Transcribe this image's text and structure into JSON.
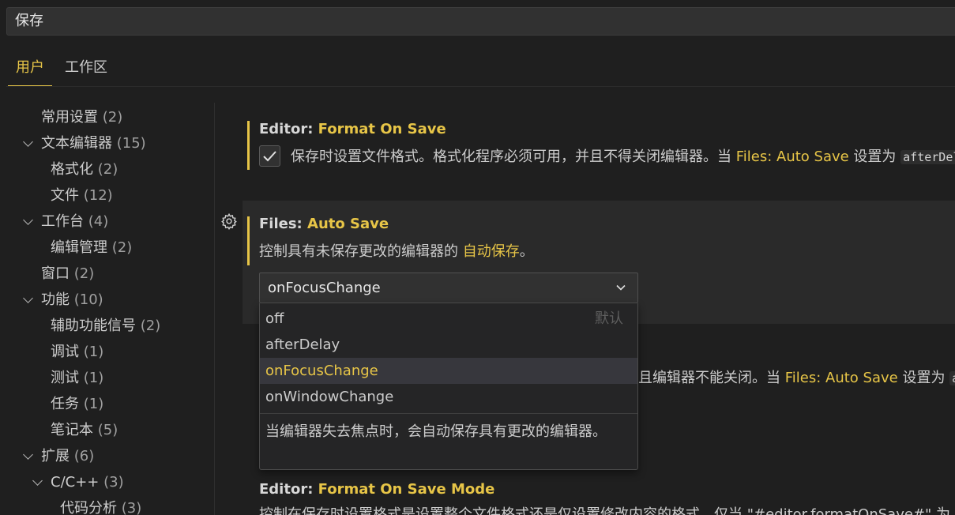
{
  "search": {
    "value": "保存"
  },
  "tabs": [
    {
      "label": "用户",
      "active": true
    },
    {
      "label": "工作区",
      "active": false
    }
  ],
  "toc": [
    {
      "label": "常用设置",
      "count": "(2)"
    },
    {
      "label": "文本编辑器",
      "count": "(15)"
    },
    {
      "label": "格式化",
      "count": "(2)"
    },
    {
      "label": "文件",
      "count": "(12)"
    },
    {
      "label": "工作台",
      "count": "(4)"
    },
    {
      "label": "编辑管理",
      "count": "(2)"
    },
    {
      "label": "窗口",
      "count": "(2)"
    },
    {
      "label": "功能",
      "count": "(10)"
    },
    {
      "label": "辅助功能信号",
      "count": "(2)"
    },
    {
      "label": "调试",
      "count": "(1)"
    },
    {
      "label": "测试",
      "count": "(1)"
    },
    {
      "label": "任务",
      "count": "(1)"
    },
    {
      "label": "笔记本",
      "count": "(5)"
    },
    {
      "label": "扩展",
      "count": "(6)"
    },
    {
      "label": "C/C++",
      "count": "(3)"
    },
    {
      "label": "代码分析",
      "count": "(3)"
    }
  ],
  "settings": {
    "format_on_save": {
      "category": "Editor: ",
      "name": "Format On Save",
      "desc_pre": "保存时设置文件格式。格式化程序必须可用，并且不得关闭编辑器。当 ",
      "desc_link": "Files: Auto Save",
      "desc_mid": " 设置为 ",
      "desc_code": "afterDelay",
      "checked": true
    },
    "auto_save": {
      "category": "Files: ",
      "name": "Auto Save",
      "desc_pre": "控制具有未保存更改的编辑器的 ",
      "desc_link": "自动保存",
      "desc_post": "。",
      "value": "onFocusChange",
      "options": [
        {
          "label": "off",
          "tag": "默认"
        },
        {
          "label": "afterDelay",
          "tag": ""
        },
        {
          "label": "onFocusChange",
          "tag": ""
        },
        {
          "label": "onWindowChange",
          "tag": ""
        }
      ],
      "selected_index": 2,
      "option_description": "当编辑器失去焦点时，会自动保存具有更改的编辑器。"
    },
    "hidden_row": {
      "desc_pre": "且编辑器不能关闭。当 ",
      "desc_link": "Files: Auto Save",
      "desc_mid": " 设置为 ",
      "desc_code": "a"
    },
    "format_on_save_mode": {
      "category": "Editor: ",
      "name": "Format On Save Mode",
      "desc": "控制在保存时设置格式是设置整个文件格式还是仅设置修改内容的格式。仅当 \"#editor.formatOnSave#\" 为"
    }
  }
}
